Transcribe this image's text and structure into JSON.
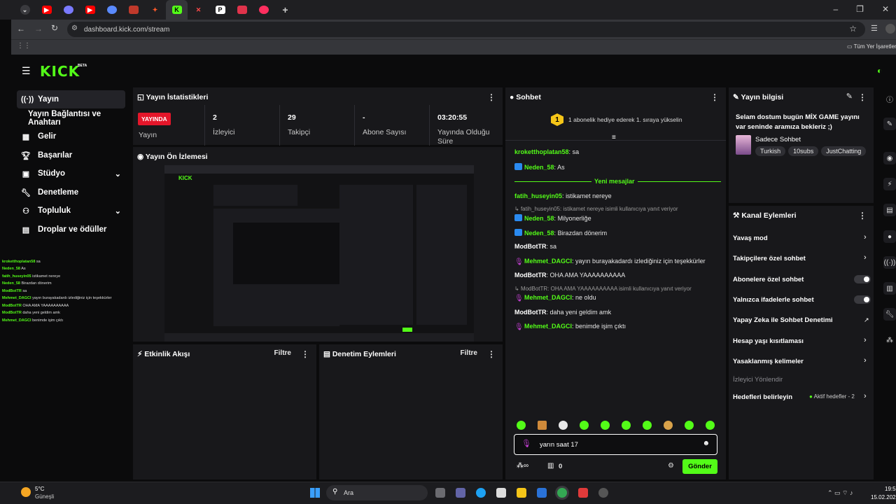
{
  "browser": {
    "url": "dashboard.kick.com/stream",
    "bookmarks_label": "Tüm Yer İşaretleri"
  },
  "nav": {
    "items": [
      {
        "label": "Yayın",
        "icon": "broadcast-icon"
      },
      {
        "label": "Yayın Bağlantısı ve Anahtarı",
        "icon": ""
      },
      {
        "label": "Gelir",
        "icon": "chart-icon"
      },
      {
        "label": "Başarılar",
        "icon": "trophy-icon"
      },
      {
        "label": "Stüdyo",
        "icon": "monitor-icon"
      },
      {
        "label": "Denetleme",
        "icon": "wrench-icon"
      },
      {
        "label": "Topluluk",
        "icon": "community-icon"
      },
      {
        "label": "Droplar ve ödüller",
        "icon": "gift-icon"
      }
    ]
  },
  "stats": {
    "title": "Yayın İstatistikleri",
    "live_badge": "YAYINDA",
    "items": [
      {
        "value": "",
        "label": "Yayın"
      },
      {
        "value": "2",
        "label": "İzleyici"
      },
      {
        "value": "29",
        "label": "Takipçi"
      },
      {
        "value": "-",
        "label": "Abone Sayısı"
      },
      {
        "value": "03:20:55",
        "label": "Yayında Olduğu Süre"
      }
    ]
  },
  "preview": {
    "title": "Yayın Ön İzlemesi"
  },
  "activity": {
    "title": "Etkinlik Akışı",
    "filter": "Filtre"
  },
  "modactions": {
    "title": "Denetim Eylemleri",
    "filter": "Filtre"
  },
  "chat": {
    "title": "Sohbet",
    "pinned": "1 abonelik hediye ederek 1. sıraya yükselin",
    "pinned_rank": "1",
    "new_messages": "Yeni mesajlar",
    "messages": [
      {
        "user": "kroketthoplatan58",
        "sep": ":",
        "text": "sa"
      },
      {
        "user": "Neden_58",
        "sep": ":",
        "text": "As"
      },
      {
        "user": "fatih_huseyin05",
        "sep": ":",
        "text": "istikamet nereye"
      },
      {
        "user": "Neden_58",
        "sep": ":",
        "text": "Milyonerliğe"
      },
      {
        "user": "Neden_58",
        "sep": ":",
        "text": "Birazdan dönerim"
      },
      {
        "user": "ModBotTR",
        "sep": ":",
        "text": "sa"
      },
      {
        "user": "Mehmet_DAGCI",
        "sep": ":",
        "text": "yayın burayakadardı izlediğiniz için teşekkürler"
      },
      {
        "user": "ModBotTR",
        "sep": ":",
        "text": "OHA AMA YAAAAAAAAAA"
      },
      {
        "user": "Mehmet_DAGCI",
        "sep": ":",
        "text": "ne oldu"
      },
      {
        "user": "ModBotTR",
        "sep": ":",
        "text": "daha yeni geldim amk"
      },
      {
        "user": "Mehmet_DAGCI",
        "sep": ":",
        "text": "benimde işim çıktı"
      }
    ],
    "replies": [
      "fatih_huseyin05: istikamet nereye isimli kullanıcıya yanıt veriyor",
      "ModBotTR: OHA AMA YAAAAAAAAAA isimli kullanıcıya yanıt veriyor"
    ],
    "input_value": "yarın saat 17",
    "send_label": "Gönder",
    "count": "0"
  },
  "stream_info": {
    "title": "Yayın bilgisi",
    "stream_title": "Selam dostum bugün MİX GAME yayını var seninde aramıza bekleriz ;)",
    "mode": "Sadece Sohbet",
    "tags": [
      "Turkish",
      "10subs",
      "JustChatting"
    ]
  },
  "channel_actions": {
    "title": "Kanal Eylemleri",
    "items": [
      {
        "label": "Yavaş mod",
        "control": "chevron"
      },
      {
        "label": "Takipçilere özel sohbet",
        "control": "chevron"
      },
      {
        "label": "Abonelere özel sohbet",
        "control": "toggle"
      },
      {
        "label": "Yalnızca ifadelerle sohbet",
        "control": "toggle"
      },
      {
        "label": "Yapay Zeka ile Sohbet Denetimi",
        "control": "external"
      },
      {
        "label": "Hesap yaşı kısıtlaması",
        "control": "chevron"
      },
      {
        "label": "Yasaklanmış kelimeler",
        "control": "chevron"
      }
    ],
    "section_label": "İzleyici Yönlendir",
    "targets_label": "Hedefleri belirleyin",
    "targets_status": "Aktif hedefler - 2"
  },
  "taskbar": {
    "weather_temp": "5°C",
    "weather_desc": "Güneşli",
    "search": "Ara",
    "time": "19:5",
    "date": "15.02.202"
  },
  "colors": {
    "accent": "#53fc18",
    "live": "#e4162a",
    "panel": "#18181b"
  }
}
